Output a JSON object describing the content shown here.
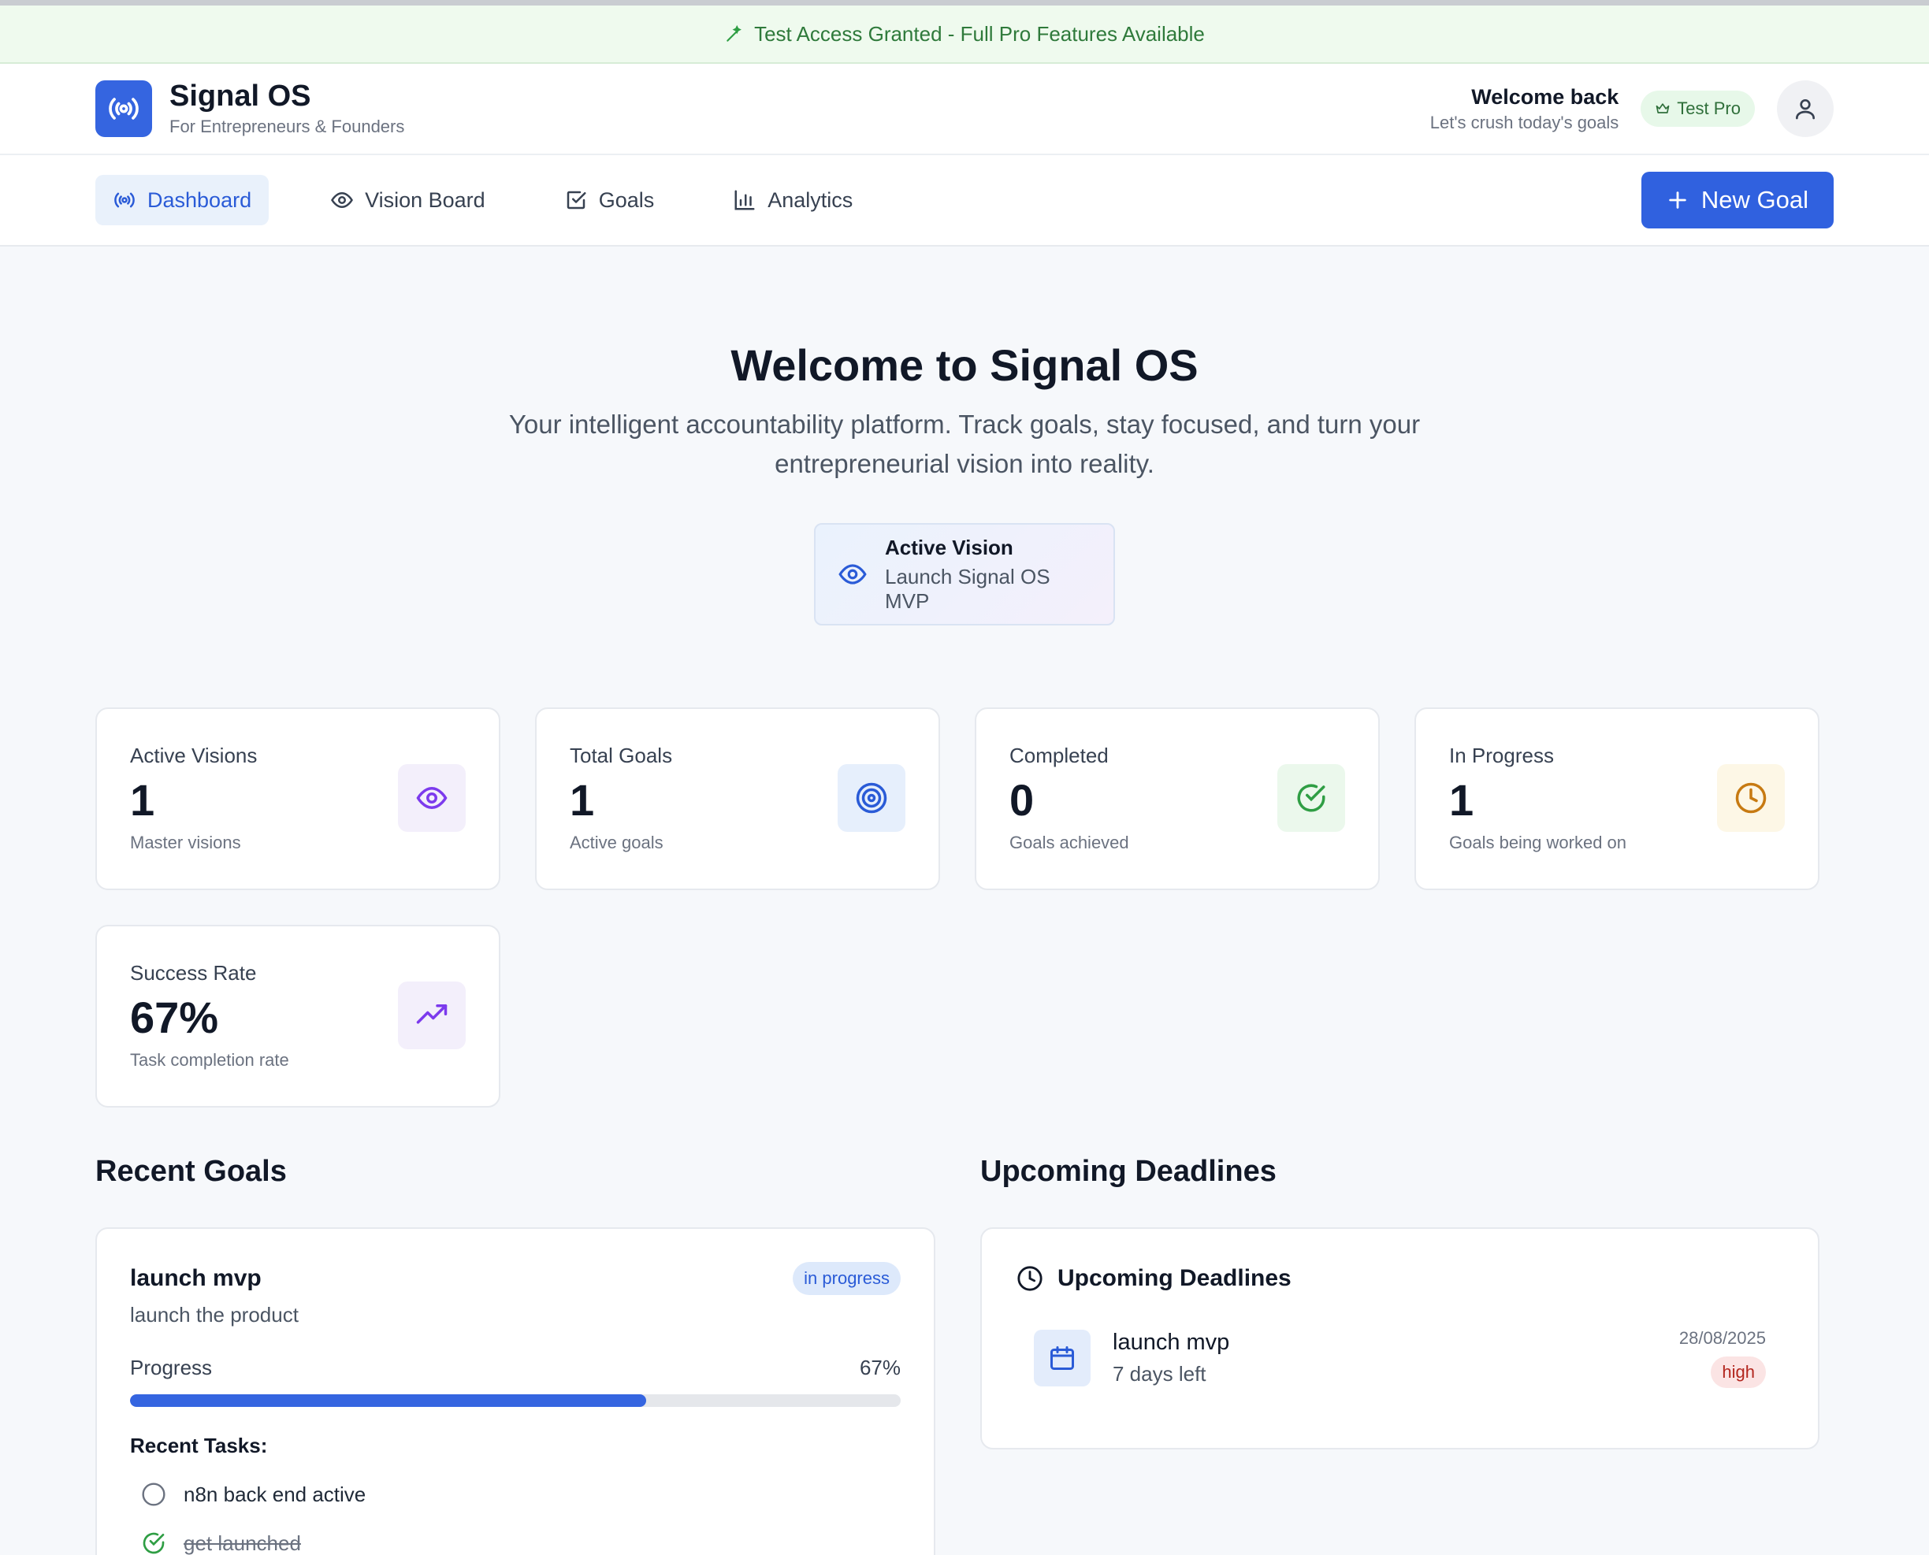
{
  "banner": {
    "text": "Test Access Granted - Full Pro Features Available",
    "icon": "wand-icon"
  },
  "header": {
    "app_name": "Signal OS",
    "tagline": "For Entrepreneurs & Founders",
    "welcome_title": "Welcome back",
    "welcome_sub": "Let's crush today's goals",
    "plan_badge": "Test Pro"
  },
  "nav": {
    "items": [
      {
        "label": "Dashboard",
        "icon": "broadcast-icon",
        "active": true
      },
      {
        "label": "Vision Board",
        "icon": "eye-icon"
      },
      {
        "label": "Goals",
        "icon": "checkbox-icon"
      },
      {
        "label": "Analytics",
        "icon": "bar-chart-icon"
      }
    ],
    "new_goal_label": "New Goal"
  },
  "hero": {
    "title": "Welcome to Signal OS",
    "subtitle": "Your intelligent accountability platform. Track goals, stay focused, and turn your entrepreneurial vision into reality.",
    "active_vision_label": "Active Vision",
    "active_vision_value": "Launch Signal OS MVP"
  },
  "stats": [
    {
      "label": "Active Visions",
      "value": "1",
      "sub": "Master visions",
      "icon": "eye-icon",
      "color": "#7c3aed",
      "bg": "#f3effb"
    },
    {
      "label": "Total Goals",
      "value": "1",
      "sub": "Active goals",
      "icon": "target-icon",
      "color": "#2a5bd7",
      "bg": "#e6effc"
    },
    {
      "label": "Completed",
      "value": "0",
      "sub": "Goals achieved",
      "icon": "check-circle-icon",
      "color": "#2f9e44",
      "bg": "#ebf8ec"
    },
    {
      "label": "In Progress",
      "value": "1",
      "sub": "Goals being worked on",
      "icon": "clock-icon",
      "color": "#c77a12",
      "bg": "#fdf7e6"
    },
    {
      "label": "Success Rate",
      "value": "67%",
      "sub": "Task completion rate",
      "icon": "trending-up-icon",
      "color": "#7c3aed",
      "bg": "#f3effb"
    }
  ],
  "recent_goals": {
    "section_title": "Recent Goals",
    "goal": {
      "title": "launch mvp",
      "description": "launch the product",
      "status": "in progress",
      "progress_label": "Progress",
      "progress_text": "67%",
      "progress_value": 67,
      "tasks_title": "Recent Tasks:",
      "tasks": [
        {
          "label": "n8n back end active",
          "done": false
        },
        {
          "label": "get launched",
          "done": true
        }
      ]
    }
  },
  "deadlines": {
    "section_title": "Upcoming Deadlines",
    "card_title": "Upcoming Deadlines",
    "items": [
      {
        "title": "launch mvp",
        "remaining": "7 days left",
        "date": "28/08/2025",
        "priority": "high"
      }
    ]
  },
  "colors": {
    "accent": "#3061df",
    "banner_text": "#2f7a3b",
    "priority_high": "#b3261e"
  }
}
